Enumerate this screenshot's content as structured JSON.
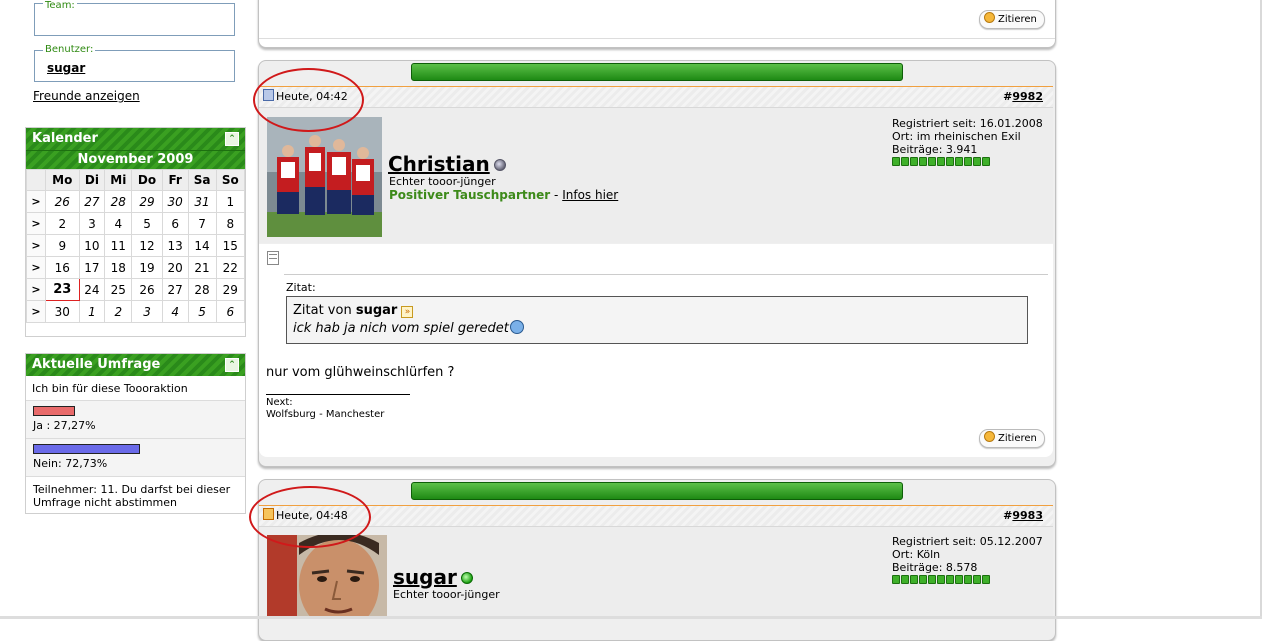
{
  "sidebar": {
    "team_label": "Team:",
    "user_label": "Benutzer:",
    "user_value": "sugar",
    "friends_link": "Freunde anzeigen",
    "calendar": {
      "title": "Kalender",
      "month": "November 2009",
      "weekdays": [
        "Mo",
        "Di",
        "Mi",
        "Do",
        "Fr",
        "Sa",
        "So"
      ],
      "week_marker": ">",
      "weeks": [
        [
          "26",
          "27",
          "28",
          "29",
          "30",
          "31",
          "1"
        ],
        [
          "2",
          "3",
          "4",
          "5",
          "6",
          "7",
          "8"
        ],
        [
          "9",
          "10",
          "11",
          "12",
          "13",
          "14",
          "15"
        ],
        [
          "16",
          "17",
          "18",
          "19",
          "20",
          "21",
          "22"
        ],
        [
          "23",
          "24",
          "25",
          "26",
          "27",
          "28",
          "29"
        ],
        [
          "30",
          "1",
          "2",
          "3",
          "4",
          "5",
          "6"
        ]
      ]
    },
    "poll": {
      "title": "Aktuelle Umfrage",
      "question": "Ich bin für diese Toooraktion",
      "options": [
        {
          "label": "Ja : 27,27%",
          "percent": 27.27,
          "color": "#e86a6a"
        },
        {
          "label": "Nein: 72,73%",
          "percent": 72.73,
          "color": "#6a6ae8"
        }
      ],
      "footer": "Teilnehmer: 11. Du darfst bei dieser Umfrage nicht abstimmen"
    }
  },
  "posts": [
    {
      "quote_button": "Zitieren"
    },
    {
      "date": "Heute, 04:42",
      "number_prefix": "#",
      "number": "9982",
      "username": "Christian",
      "user_title": "Echter tooor-jünger",
      "trader_status": "Positiver Tauschpartner",
      "separator": " - ",
      "info_link": "Infos hier",
      "registered": "Registriert seit: 16.01.2008",
      "location": "Ort: im rheinischen Exil",
      "post_count": "Beiträge: 3.941",
      "quote_caption": "Zitat:",
      "quote_from_prefix": "Zitat von",
      "quote_author": "sugar",
      "quote_text": "ick hab ja nich vom spiel geredet",
      "message": "nur vom glühweinschlürfen ?",
      "signature_line1": "Next:",
      "signature_line2": "Wolfsburg - Manchester",
      "quote_button": "Zitieren",
      "online": false
    },
    {
      "date": "Heute, 04:48",
      "number_prefix": "#",
      "number": "9983",
      "username": "sugar",
      "user_title": "Echter tooor-jünger",
      "registered": "Registriert seit: 05.12.2007",
      "location": "Ort: Köln",
      "post_count": "Beiträge: 8.578",
      "online": true
    }
  ],
  "colors": {
    "accent_green": "#2a8a1a",
    "trader_green": "#3d8a1a",
    "highlight_ring": "#d0191a"
  }
}
